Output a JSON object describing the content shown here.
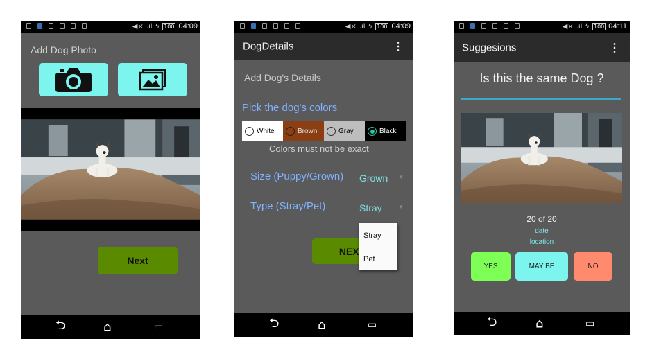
{
  "status_bar": {
    "times": [
      "04:09",
      "04:09",
      "04:11"
    ],
    "battery": "100"
  },
  "screen1": {
    "heading": "Add Dog Photo",
    "camera_button_icon": "camera-icon",
    "gallery_button_icon": "image-icon",
    "next_label": "Next"
  },
  "screen2": {
    "app_title": "DogDetails",
    "heading": "Add Dog's Details",
    "colors_label": "Pick the dog's colors",
    "color_options": [
      {
        "label": "White",
        "bg": "#ffffff",
        "fg": "#000000",
        "selected": false
      },
      {
        "label": "Brown",
        "bg": "#8a3e12",
        "fg": "#ffffff",
        "selected": false
      },
      {
        "label": "Gray",
        "bg": "#bdbdbd",
        "fg": "#000000",
        "selected": false
      },
      {
        "label": "Black",
        "bg": "#000000",
        "fg": "#ffffff",
        "selected": true
      }
    ],
    "colors_hint": "Colors must not be exact",
    "size_label": "Size (Puppy/Grown)",
    "size_value": "Grown",
    "type_label": "Type (Stray/Pet)",
    "type_value": "Stray",
    "dropdown_options": [
      "Stray",
      "Pet"
    ],
    "next_label": "NEXT"
  },
  "screen3": {
    "app_title": "Suggesions",
    "question": "Is this the same Dog ?",
    "counter": "20 of 20",
    "date_label": "date",
    "location_label": "location",
    "yes_label": "YES",
    "maybe_label": "MAY BE",
    "no_label": "NO"
  },
  "colors": {
    "accent_blue": "#7fb2ff",
    "cyan_button": "#7cf5ee",
    "next_green": "#5a8a00",
    "yes_green": "#7dff55",
    "no_salmon": "#ff8a6e",
    "radio_teal": "#24c7a8"
  }
}
